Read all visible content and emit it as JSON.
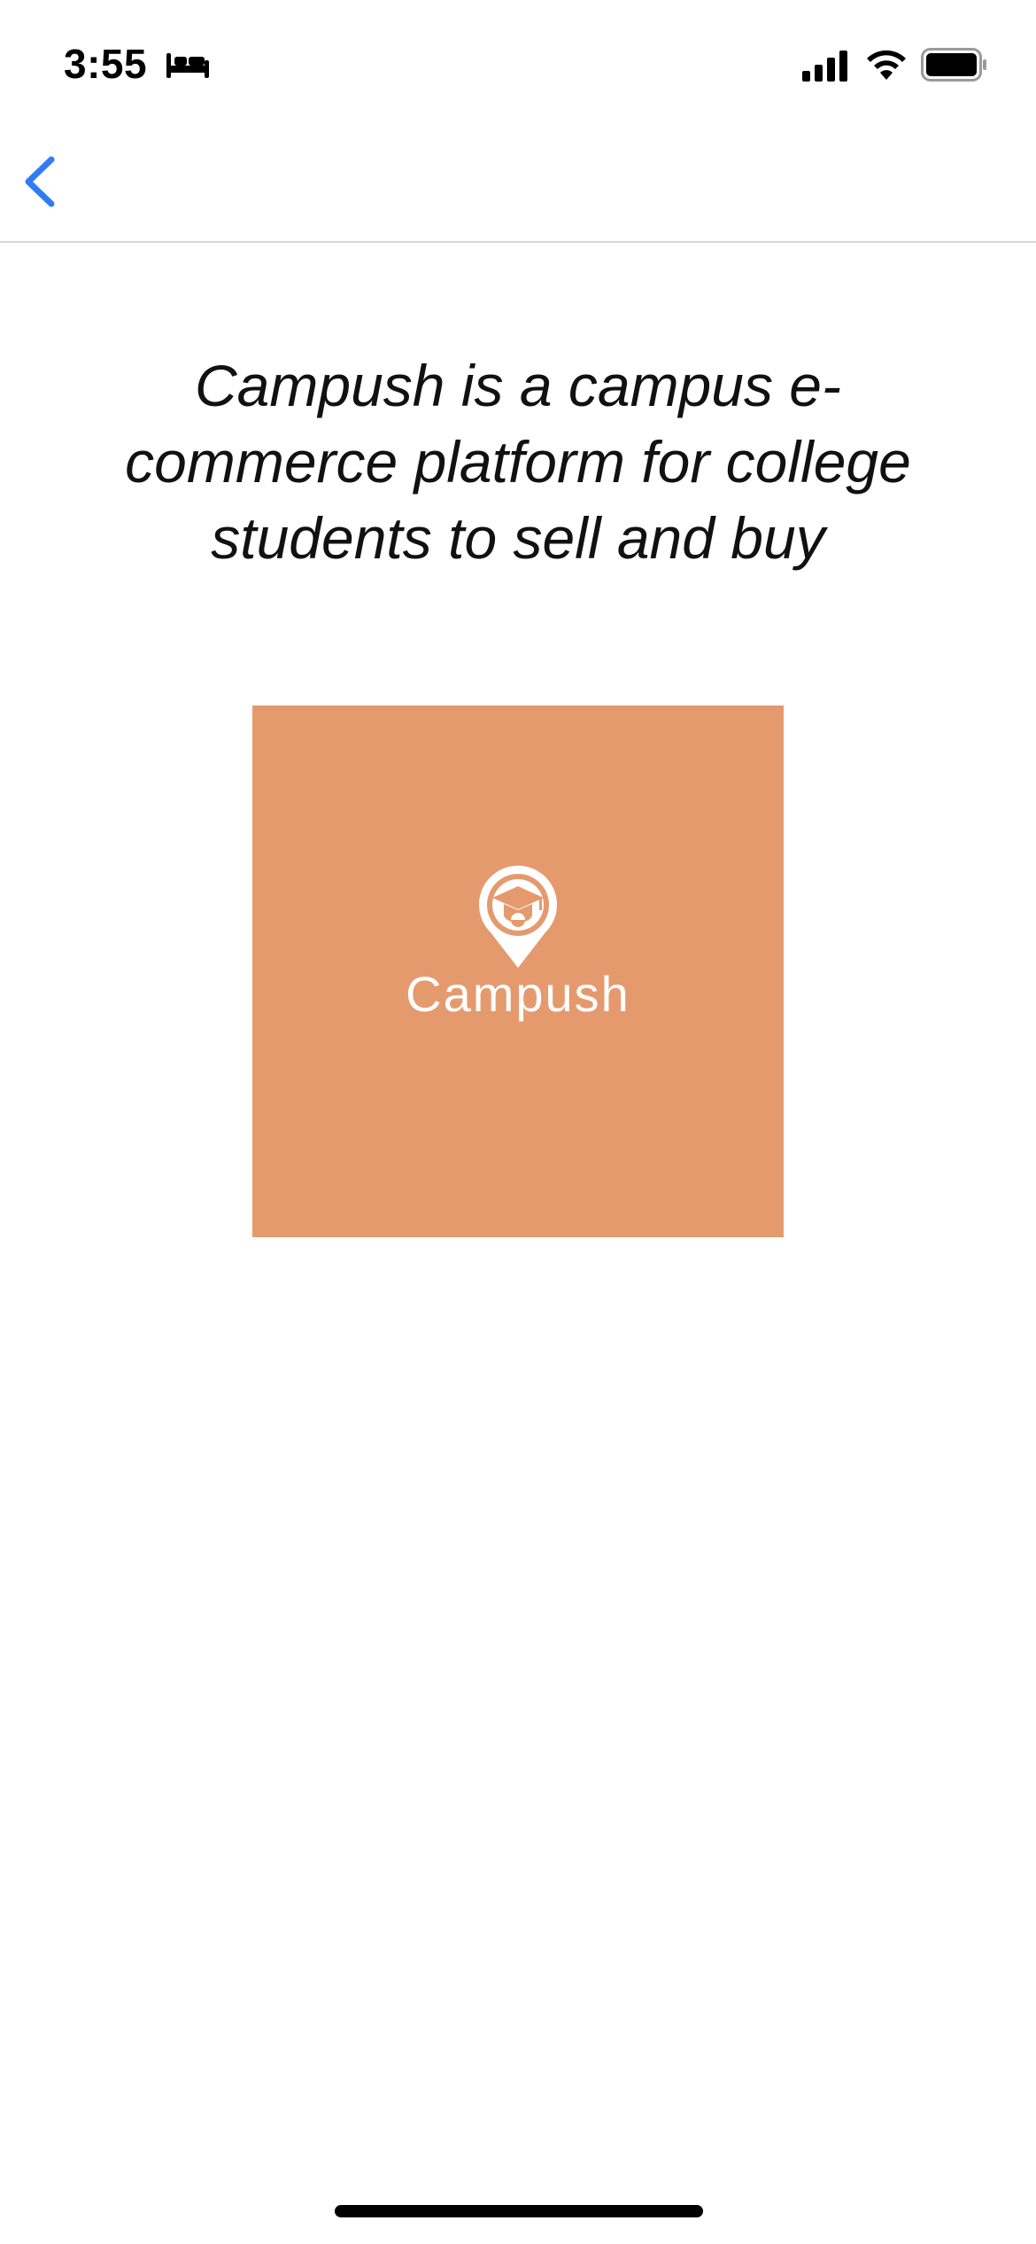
{
  "status_bar": {
    "time": "3:55"
  },
  "icons": {
    "bed": "bed-icon",
    "signal": "cellular-signal-icon",
    "wifi": "wifi-icon",
    "battery": "battery-icon",
    "back": "chevron-left-icon",
    "logo": "map-pin-graduation-cap-icon"
  },
  "main": {
    "description": "Campush is a campus e-commerce platform for college students to sell and buy",
    "logo": {
      "text": "Campush",
      "background": "#e59a6e"
    }
  },
  "colors": {
    "accent": "#2f7cf6",
    "logo_background": "#e59a6e"
  }
}
